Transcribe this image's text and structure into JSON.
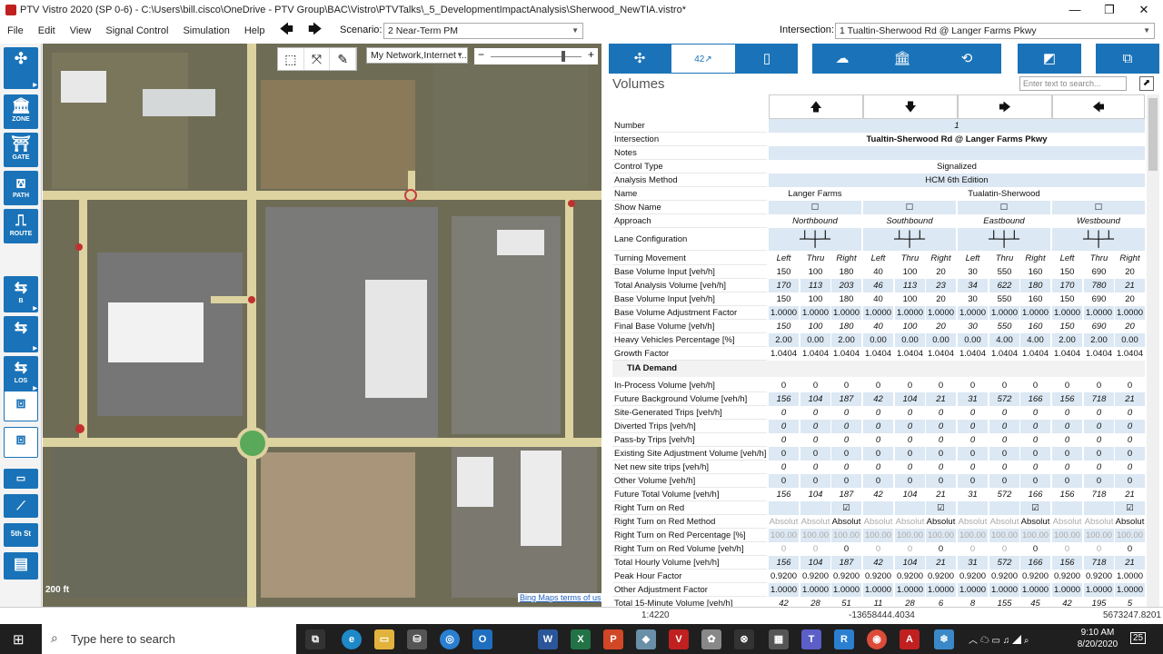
{
  "titlebar": {
    "title": "PTV Vistro 2020 (SP  0-6) - C:\\Users\\bill.cisco\\OneDrive - PTV Group\\BAC\\Vistro\\PTVTalks\\_5_DevelopmentImpactAnalysis\\Sherwood_NewTIA.vistro*",
    "minimize": "—",
    "maximize": "❐",
    "close": "✕"
  },
  "menu": {
    "items": [
      "File",
      "Edit",
      "View",
      "Signal Control",
      "Simulation",
      "Help"
    ],
    "back": "🡄",
    "forward": "🡆"
  },
  "scenario": {
    "label": "Scenario:",
    "value": "2 Near-Term PM"
  },
  "intersection": {
    "label": "Intersection:",
    "value": "1 Tualtin-Sherwood Rd @ Langer Farms Pkwy"
  },
  "leftbar": {
    "buttons": [
      {
        "icon": "✣",
        "label": ""
      },
      {
        "icon": "🏛",
        "label": "ZONE"
      },
      {
        "icon": "⛩",
        "label": "GATE"
      },
      {
        "icon": "⟎",
        "label": "PATH"
      },
      {
        "icon": "⎍",
        "label": "ROUTE"
      },
      {
        "icon": "⇆",
        "label": "B"
      },
      {
        "icon": "⇆",
        "label": ""
      },
      {
        "icon": "⇆",
        "label": "LOS"
      },
      {
        "icon": "⧈",
        "label": ""
      },
      {
        "icon": "⧈",
        "label": ""
      },
      {
        "icon": "▭",
        "label": ""
      },
      {
        "icon": "⟋",
        "label": ""
      },
      {
        "icon": "▤",
        "label": "5th St"
      },
      {
        "icon": "▤",
        "label": ""
      }
    ]
  },
  "map": {
    "toolbar": [
      "⬚",
      "⤧",
      "✎"
    ],
    "layer_select": "My Network,Internet ...",
    "zoom_minus": "−",
    "zoom_plus": "+",
    "scale": "200 ft",
    "credit": "Bing Maps terms of us"
  },
  "panel": {
    "title": "Volumes",
    "search_placeholder": "Enter text to search...",
    "export_icon": "⬈",
    "tabs": [
      "✣",
      "42↗",
      "▯",
      "☁",
      "🏛",
      "⟲",
      "◩",
      "⧉"
    ],
    "direction_arrows": [
      "🡅",
      "🡇",
      "🡆",
      "🡄"
    ],
    "number": {
      "label": "Number",
      "value": "1"
    },
    "intersection": {
      "label": "Intersection",
      "value": "Tualtin-Sherwood Rd @ Langer Farms Pkwy"
    },
    "notes": {
      "label": "Notes",
      "value": ""
    },
    "control_type": {
      "label": "Control Type",
      "value": "Signalized"
    },
    "analysis_method": {
      "label": "Analysis Method",
      "value": "HCM 6th Edition"
    },
    "name": {
      "label": "Name",
      "values": [
        "Langer Farms",
        "",
        "Tualatin-Sherwood",
        ""
      ]
    },
    "show_name": {
      "label": "Show Name",
      "values": [
        "☐",
        "☐",
        "☐",
        "☐"
      ]
    },
    "approach": {
      "label": "Approach",
      "values": [
        "Northbound",
        "Southbound",
        "Eastbound",
        "Westbound"
      ]
    },
    "lane_config": {
      "label": "Lane Configuration",
      "icon": "┴┼┴"
    },
    "turning": {
      "label": "Turning Movement",
      "values": [
        "Left",
        "Thru",
        "Right",
        "Left",
        "Thru",
        "Right",
        "Left",
        "Thru",
        "Right",
        "Left",
        "Thru",
        "Right"
      ]
    },
    "rows": [
      {
        "label": "Base Volume Input [veh/h]",
        "values": [
          "150",
          "100",
          "180",
          "40",
          "100",
          "20",
          "30",
          "550",
          "160",
          "150",
          "690",
          "20"
        ],
        "style": ""
      },
      {
        "label": "Total Analysis Volume [veh/h]",
        "values": [
          "170",
          "113",
          "203",
          "46",
          "113",
          "23",
          "34",
          "622",
          "180",
          "170",
          "780",
          "21"
        ],
        "style": "italic"
      },
      {
        "label": "Base Volume Input [veh/h]",
        "values": [
          "150",
          "100",
          "180",
          "40",
          "100",
          "20",
          "30",
          "550",
          "160",
          "150",
          "690",
          "20"
        ],
        "style": ""
      },
      {
        "label": "Base Volume Adjustment Factor",
        "values": [
          "1.0000",
          "1.0000",
          "1.0000",
          "1.0000",
          "1.0000",
          "1.0000",
          "1.0000",
          "1.0000",
          "1.0000",
          "1.0000",
          "1.0000",
          "1.0000"
        ],
        "style": ""
      },
      {
        "label": "Final Base Volume [veh/h]",
        "values": [
          "150",
          "100",
          "180",
          "40",
          "100",
          "20",
          "30",
          "550",
          "160",
          "150",
          "690",
          "20"
        ],
        "style": "italic"
      },
      {
        "label": "Heavy Vehicles Percentage [%]",
        "values": [
          "2.00",
          "0.00",
          "2.00",
          "0.00",
          "0.00",
          "0.00",
          "0.00",
          "4.00",
          "4.00",
          "2.00",
          "2.00",
          "0.00"
        ],
        "style": ""
      },
      {
        "label": "Growth Factor",
        "values": [
          "1.0404",
          "1.0404",
          "1.0404",
          "1.0404",
          "1.0404",
          "1.0404",
          "1.0404",
          "1.0404",
          "1.0404",
          "1.0404",
          "1.0404",
          "1.0404"
        ],
        "style": ""
      }
    ],
    "section": "TIA Demand",
    "rows2": [
      {
        "label": "In-Process Volume [veh/h]",
        "values": [
          "0",
          "0",
          "0",
          "0",
          "0",
          "0",
          "0",
          "0",
          "0",
          "0",
          "0",
          "0"
        ],
        "style": ""
      },
      {
        "label": "Future Background Volume [veh/h]",
        "values": [
          "156",
          "104",
          "187",
          "42",
          "104",
          "21",
          "31",
          "572",
          "166",
          "156",
          "718",
          "21"
        ],
        "style": "italic"
      },
      {
        "label": "Site-Generated Trips [veh/h]",
        "values": [
          "0",
          "0",
          "0",
          "0",
          "0",
          "0",
          "0",
          "0",
          "0",
          "0",
          "0",
          "0"
        ],
        "style": "italic"
      },
      {
        "label": "Diverted Trips [veh/h]",
        "values": [
          "0",
          "0",
          "0",
          "0",
          "0",
          "0",
          "0",
          "0",
          "0",
          "0",
          "0",
          "0"
        ],
        "style": "italic"
      },
      {
        "label": "Pass-by Trips [veh/h]",
        "values": [
          "0",
          "0",
          "0",
          "0",
          "0",
          "0",
          "0",
          "0",
          "0",
          "0",
          "0",
          "0"
        ],
        "style": "italic"
      },
      {
        "label": "Existing Site Adjustment Volume [veh/h]",
        "values": [
          "0",
          "0",
          "0",
          "0",
          "0",
          "0",
          "0",
          "0",
          "0",
          "0",
          "0",
          "0"
        ],
        "style": ""
      },
      {
        "label": "Net new site trips [veh/h]",
        "values": [
          "0",
          "0",
          "0",
          "0",
          "0",
          "0",
          "0",
          "0",
          "0",
          "0",
          "0",
          "0"
        ],
        "style": "italic"
      },
      {
        "label": "Other Volume [veh/h]",
        "values": [
          "0",
          "0",
          "0",
          "0",
          "0",
          "0",
          "0",
          "0",
          "0",
          "0",
          "0",
          "0"
        ],
        "style": ""
      },
      {
        "label": "Future Total Volume [veh/h]",
        "values": [
          "156",
          "104",
          "187",
          "42",
          "104",
          "21",
          "31",
          "572",
          "166",
          "156",
          "718",
          "21"
        ],
        "style": "italic"
      },
      {
        "label": "Right Turn on Red",
        "values": [
          "",
          "",
          "☑",
          "",
          "",
          "☑",
          "",
          "",
          "☑",
          "",
          "",
          "☑"
        ],
        "style": ""
      },
      {
        "label": "Right Turn on Red Method",
        "values": [
          "Absolut",
          "Absolut",
          "Absolut",
          "Absolut",
          "Absolut",
          "Absolut",
          "Absolut",
          "Absolut",
          "Absolut",
          "Absolut",
          "Absolut",
          "Absolut"
        ],
        "style": "rtor"
      },
      {
        "label": "Right Turn on Red Percentage [%]",
        "values": [
          "100.00",
          "100.00",
          "100.00",
          "100.00",
          "100.00",
          "100.00",
          "100.00",
          "100.00",
          "100.00",
          "100.00",
          "100.00",
          "100.00"
        ],
        "style": "gray"
      },
      {
        "label": "Right Turn on Red Volume [veh/h]",
        "values": [
          "0",
          "0",
          "0",
          "0",
          "0",
          "0",
          "0",
          "0",
          "0",
          "0",
          "0",
          "0"
        ],
        "style": "rtorv"
      },
      {
        "label": "Total Hourly Volume [veh/h]",
        "values": [
          "156",
          "104",
          "187",
          "42",
          "104",
          "21",
          "31",
          "572",
          "166",
          "156",
          "718",
          "21"
        ],
        "style": "italic"
      },
      {
        "label": "Peak Hour Factor",
        "values": [
          "0.9200",
          "0.9200",
          "0.9200",
          "0.9200",
          "0.9200",
          "0.9200",
          "0.9200",
          "0.9200",
          "0.9200",
          "0.9200",
          "0.9200",
          "1.0000"
        ],
        "style": ""
      },
      {
        "label": "Other Adjustment Factor",
        "values": [
          "1.0000",
          "1.0000",
          "1.0000",
          "1.0000",
          "1.0000",
          "1.0000",
          "1.0000",
          "1.0000",
          "1.0000",
          "1.0000",
          "1.0000",
          "1.0000"
        ],
        "style": ""
      },
      {
        "label": "Total 15-Minute Volume [veh/h]",
        "values": [
          "42",
          "28",
          "51",
          "11",
          "28",
          "6",
          "8",
          "155",
          "45",
          "42",
          "195",
          "5"
        ],
        "style": "italic"
      }
    ]
  },
  "status": {
    "scale": "1:4220",
    "x": "-13658444.4034",
    "y": "5673247.8201"
  },
  "taskbar": {
    "search": "Type here to search",
    "time": "9:10 AM",
    "date": "8/20/2020",
    "notif": "25"
  }
}
